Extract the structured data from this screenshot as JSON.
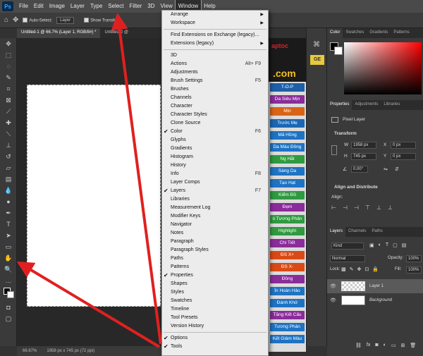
{
  "menubar": {
    "logo": "Ps",
    "items": [
      "File",
      "Edit",
      "Image",
      "Layer",
      "Type",
      "Select",
      "Filter",
      "3D",
      "View",
      "Window",
      "Help"
    ]
  },
  "options": {
    "auto_select": "Auto-Select:",
    "layer_select": "Layer",
    "show_transform": "Show Transform"
  },
  "tabs": [
    "Untitled-1 @ 66.7% (Layer 1, RGB/8#) *",
    "Untitled-2 @"
  ],
  "status": {
    "zoom": "66.67%",
    "size": "1958 px x 745 px (72 ppi)"
  },
  "window_menu": [
    {
      "label": "Arrange",
      "submenu": true
    },
    {
      "label": "Workspace",
      "submenu": true
    },
    {
      "sep": true
    },
    {
      "label": "Find Extensions on Exchange (legacy)..."
    },
    {
      "label": "Extensions (legacy)",
      "submenu": true
    },
    {
      "sep": true
    },
    {
      "label": "3D"
    },
    {
      "label": "Actions",
      "shortcut": "Alt+ F9"
    },
    {
      "label": "Adjustments"
    },
    {
      "label": "Brush Settings",
      "shortcut": "F5"
    },
    {
      "label": "Brushes"
    },
    {
      "label": "Channels"
    },
    {
      "label": "Character"
    },
    {
      "label": "Character Styles"
    },
    {
      "label": "Clone Source"
    },
    {
      "label": "Color",
      "shortcut": "F6",
      "checked": true
    },
    {
      "label": "Glyphs"
    },
    {
      "label": "Gradients"
    },
    {
      "label": "Histogram"
    },
    {
      "label": "History"
    },
    {
      "label": "Info",
      "shortcut": "F8"
    },
    {
      "label": "Layer Comps"
    },
    {
      "label": "Layers",
      "shortcut": "F7",
      "checked": true
    },
    {
      "label": "Libraries"
    },
    {
      "label": "Measurement Log"
    },
    {
      "label": "Modifier Keys"
    },
    {
      "label": "Navigator"
    },
    {
      "label": "Notes"
    },
    {
      "label": "Paragraph"
    },
    {
      "label": "Paragraph Styles"
    },
    {
      "label": "Paths"
    },
    {
      "label": "Patterns"
    },
    {
      "label": "Properties",
      "checked": true
    },
    {
      "label": "Shapes"
    },
    {
      "label": "Styles"
    },
    {
      "label": "Swatches"
    },
    {
      "label": "Timeline"
    },
    {
      "label": "Tool Presets"
    },
    {
      "label": "Version History"
    },
    {
      "sep": true
    },
    {
      "label": "Options",
      "checked": true
    },
    {
      "label": "Tools",
      "checked": true
    }
  ],
  "website": {
    "logo_top": "aptoc",
    "logo_bottom": ".com",
    "ge": "GE",
    "buttons": [
      {
        "label": "T-O-P",
        "color": "#1d5fa8"
      },
      {
        "label": "Da Siêu Mịn",
        "color": "#8a2c9a"
      },
      {
        "label": "Mịn",
        "color": "#d96416"
      },
      {
        "label": "Trước Mẹ",
        "color": "#1b67b4"
      },
      {
        "label": "Mã Hồng",
        "color": "#1e73c2"
      },
      {
        "label": "Da Màu Đồng",
        "color": "#1e73c2"
      },
      {
        "label": "Ng Hắt",
        "color": "#2f9a40"
      },
      {
        "label": "Sáng Da",
        "color": "#1e73c2"
      },
      {
        "label": "Tạo Hạt",
        "color": "#1e73c2"
      },
      {
        "label": "Kiểm Đồ",
        "color": "#2f9a40"
      },
      {
        "label": "Đẹm",
        "color": "#8a2c9a"
      },
      {
        "label": "ò Tương Phản",
        "color": "#2f9a40"
      },
      {
        "label": "Highlight",
        "color": "#2f9a40"
      },
      {
        "label": "Chi Tiết",
        "color": "#8a2c9a"
      },
      {
        "label": "ĐS X+",
        "color": "#d94a16"
      },
      {
        "label": "ĐS X-",
        "color": "#d94a16"
      },
      {
        "label": "Đồng",
        "color": "#8a2c9a"
      },
      {
        "label": "Ìn Hoàn Hảo",
        "color": "#1e73c2"
      },
      {
        "label": "Đánh Khử",
        "color": "#1e73c2"
      },
      {
        "label": "Tăng Kết Cấu",
        "color": "#8a2c9a"
      },
      {
        "label": "Tương Phản",
        "color": "#1e73c2"
      },
      {
        "label": "Kết Giảm Màu",
        "color": "#1e73c2"
      }
    ]
  },
  "color_panel": {
    "tabs": [
      "Color",
      "Swatches",
      "Gradients",
      "Patterns"
    ]
  },
  "properties": {
    "tabs": [
      "Properties",
      "Adjustments",
      "Libraries"
    ],
    "kind": "Pixel Layer",
    "transform_label": "Transform",
    "w_label": "W",
    "w": "1958 px",
    "h_label": "H",
    "h": "745 px",
    "x_label": "X",
    "x": "0 px",
    "y_label": "Y",
    "y": "0 px",
    "angle": "0.00°",
    "align_label": "Align and Distribute",
    "align_sub": "Align:"
  },
  "layers_panel": {
    "tabs": [
      "Layers",
      "Channels",
      "Paths"
    ],
    "kind": "Kind",
    "blend": "Normal",
    "opacity_label": "Opacity:",
    "opacity": "100%",
    "lock_label": "Lock:",
    "fill_label": "Fill:",
    "fill": "100%",
    "layers": [
      {
        "name": "Layer 1",
        "type": "transparent"
      },
      {
        "name": "Background",
        "type": "white"
      }
    ]
  }
}
